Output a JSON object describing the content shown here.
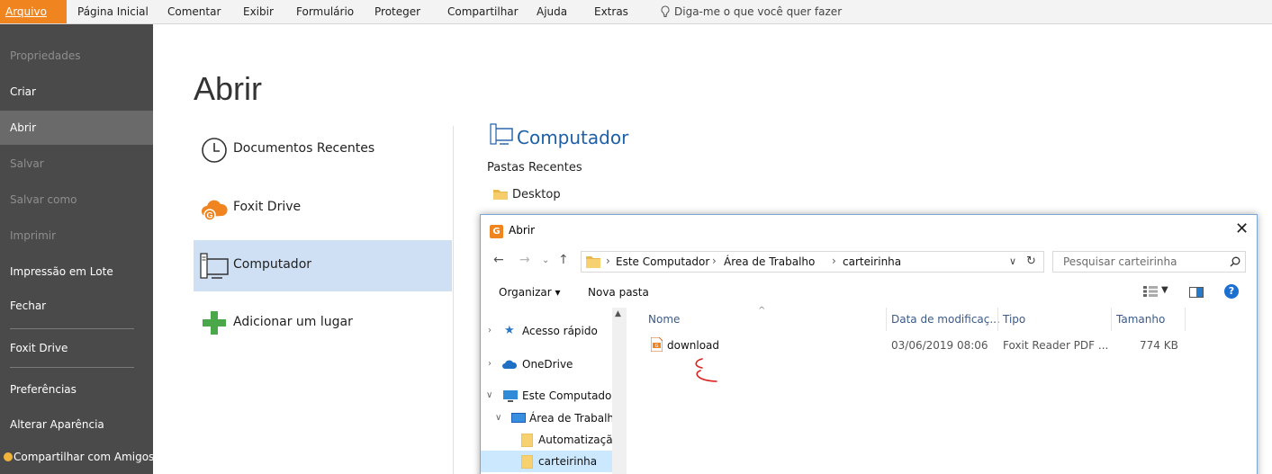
{
  "ribbon": {
    "tabs": [
      "Arquivo",
      "Página Inicial",
      "Comentar",
      "Exibir",
      "Formulário",
      "Proteger",
      "Compartilhar",
      "Ajuda",
      "Extras"
    ],
    "tell_me": "Diga-me o que você quer fazer"
  },
  "sidebar": {
    "items": [
      "Propriedades",
      "Criar",
      "Abrir",
      "Salvar",
      "Salvar como",
      "Imprimir",
      "Impressão em Lote",
      "Fechar",
      "Foxit Drive",
      "Preferências",
      "Alterar Aparência",
      "Compartilhar com Amigos"
    ],
    "disabled": [
      "Propriedades",
      "Salvar",
      "Salvar como",
      "Imprimir"
    ],
    "selected": "Abrir"
  },
  "main": {
    "title": "Abrir",
    "places": [
      "Documentos Recentes",
      "Foxit Drive",
      "Computador",
      "Adicionar um lugar"
    ],
    "selected_place": "Computador",
    "computer_heading": "Computador",
    "recent_folders_label": "Pastas Recentes",
    "recent_folders": [
      "Desktop"
    ]
  },
  "dialog": {
    "title": "Abrir",
    "close_glyph": "✕",
    "breadcrumb": [
      "Este Computador",
      "Área de Trabalho",
      "carteirinha"
    ],
    "search_placeholder": "Pesquisar carteirinha",
    "organize_label": "Organizar ▾",
    "new_folder_label": "Nova pasta",
    "help_glyph": "?",
    "tree": [
      "Acesso rápido",
      "OneDrive",
      "Este Computador",
      "Área de Trabalho",
      "Automatização",
      "carteirinha"
    ],
    "tree_selected": "carteirinha",
    "columns": [
      "Nome",
      "Data de modificaç...",
      "Tipo",
      "Tamanho"
    ],
    "files": [
      {
        "name": "download",
        "modified": "03/06/2019 08:06",
        "type": "Foxit Reader PDF ...",
        "size": "774 KB"
      }
    ]
  },
  "colors": {
    "accent": "#f0841f",
    "sidebar_bg": "#4a4a4a",
    "selection": "#cfe0f5",
    "heading_blue": "#1e5fa8",
    "annotation_red": "#d9231f"
  }
}
